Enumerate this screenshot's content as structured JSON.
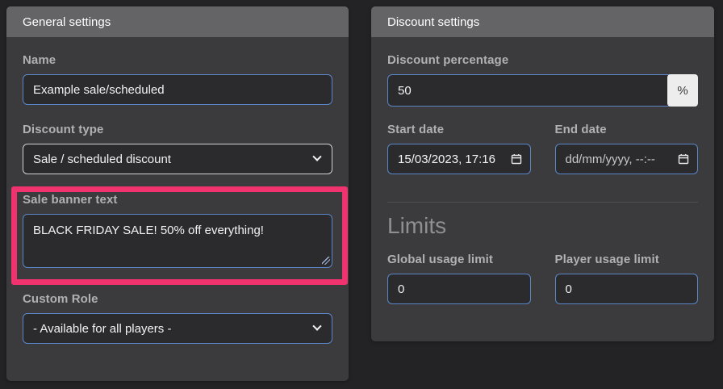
{
  "colors": {
    "accent_border": "#5b87c9",
    "highlight": "#f0326e",
    "panel_bg": "#3b3b3d",
    "header_bg": "#646467",
    "percent_addon_bg": "#ededee"
  },
  "general_panel": {
    "title": "General settings",
    "name": {
      "label": "Name",
      "value": "Example sale/scheduled"
    },
    "discount_type": {
      "label": "Discount type",
      "value": "Sale / scheduled discount"
    },
    "sale_banner": {
      "label": "Sale banner text",
      "value": "BLACK FRIDAY SALE! 50% off everything!"
    },
    "custom_role": {
      "label": "Custom Role",
      "value": "- Available for all players -"
    }
  },
  "discount_panel": {
    "title": "Discount settings",
    "percentage": {
      "label": "Discount percentage",
      "value": "50",
      "suffix": "%"
    },
    "start_date": {
      "label": "Start date",
      "value": "15/03/2023, 17:16"
    },
    "end_date": {
      "label": "End date",
      "placeholder": "dd/mm/yyyy, --:--"
    },
    "limits": {
      "heading": "Limits",
      "global": {
        "label": "Global usage limit",
        "value": "0"
      },
      "player": {
        "label": "Player usage limit",
        "value": "0"
      }
    }
  },
  "icons": {
    "calendar": "calendar-icon",
    "chevron": "chevron-down-icon",
    "resize": "resize-grip-icon"
  }
}
